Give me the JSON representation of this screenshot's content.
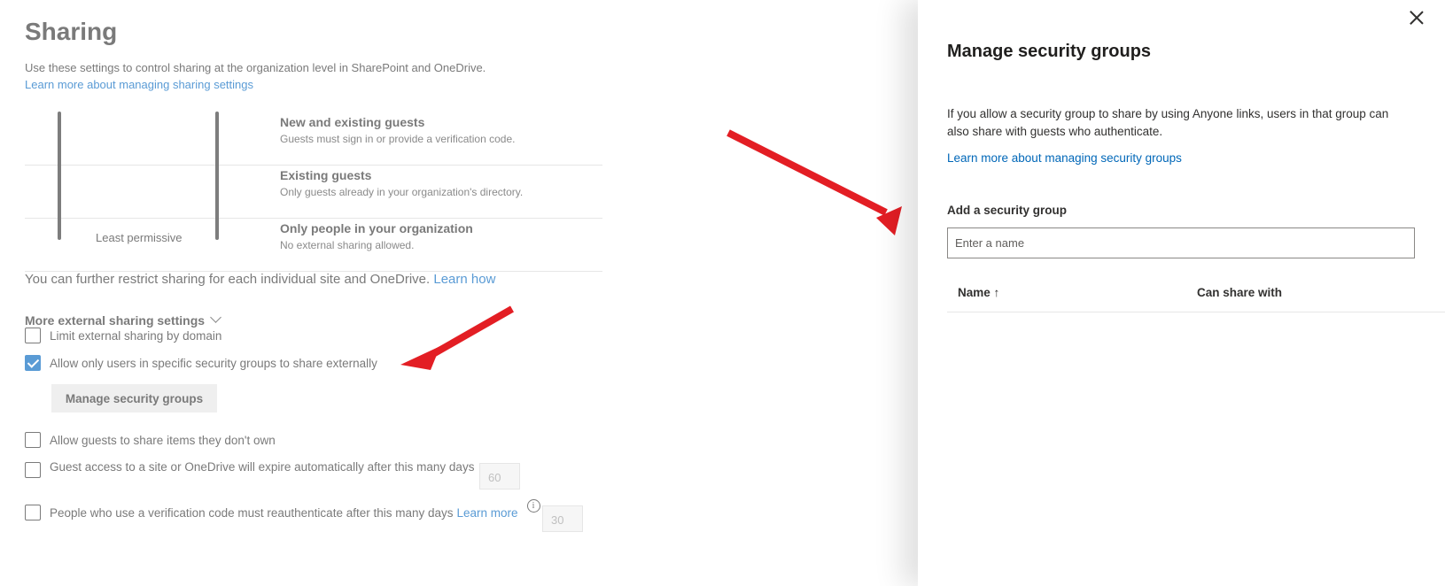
{
  "page": {
    "title": "Sharing",
    "description": "Use these settings to control sharing at the organization level in SharePoint and OneDrive.",
    "learn_more_link": "Learn more about managing sharing settings",
    "levels": [
      {
        "title": "New and existing guests",
        "desc": "Guests must sign in or provide a verification code."
      },
      {
        "title": "Existing guests",
        "desc": "Only guests already in your organization's directory."
      },
      {
        "title": "Only people in your organization",
        "desc": "No external sharing allowed."
      }
    ],
    "least_permissive_label": "Least permissive",
    "restrict_text": "You can further restrict sharing for each individual site and OneDrive.",
    "restrict_link": "Learn how",
    "more_external_label": "More external sharing settings",
    "options": [
      {
        "label": "Limit external sharing by domain",
        "checked": false
      },
      {
        "label": "Allow only users in specific security groups to share externally",
        "checked": true
      },
      {
        "label": "Allow guests to share items they don't own",
        "checked": false
      },
      {
        "label": "Guest access to a site or OneDrive will expire automatically after this many days",
        "checked": false,
        "value": "60"
      },
      {
        "label": "People who use a verification code must reauthenticate after this many days",
        "checked": false,
        "value": "30",
        "link": "Learn more"
      }
    ],
    "manage_button": "Manage security groups"
  },
  "panel": {
    "title": "Manage security groups",
    "description": "If you allow a security group to share by using Anyone links, users in that group can also share with guests who authenticate.",
    "learn_link": "Learn more about managing security groups",
    "add_label": "Add a security group",
    "input_placeholder": "Enter a name",
    "columns": {
      "name": "Name ↑",
      "can_share": "Can share with"
    }
  },
  "colors": {
    "arrow": "#e31e24",
    "link": "#0067b8",
    "checkbox_checked": "#5a9bd5"
  }
}
